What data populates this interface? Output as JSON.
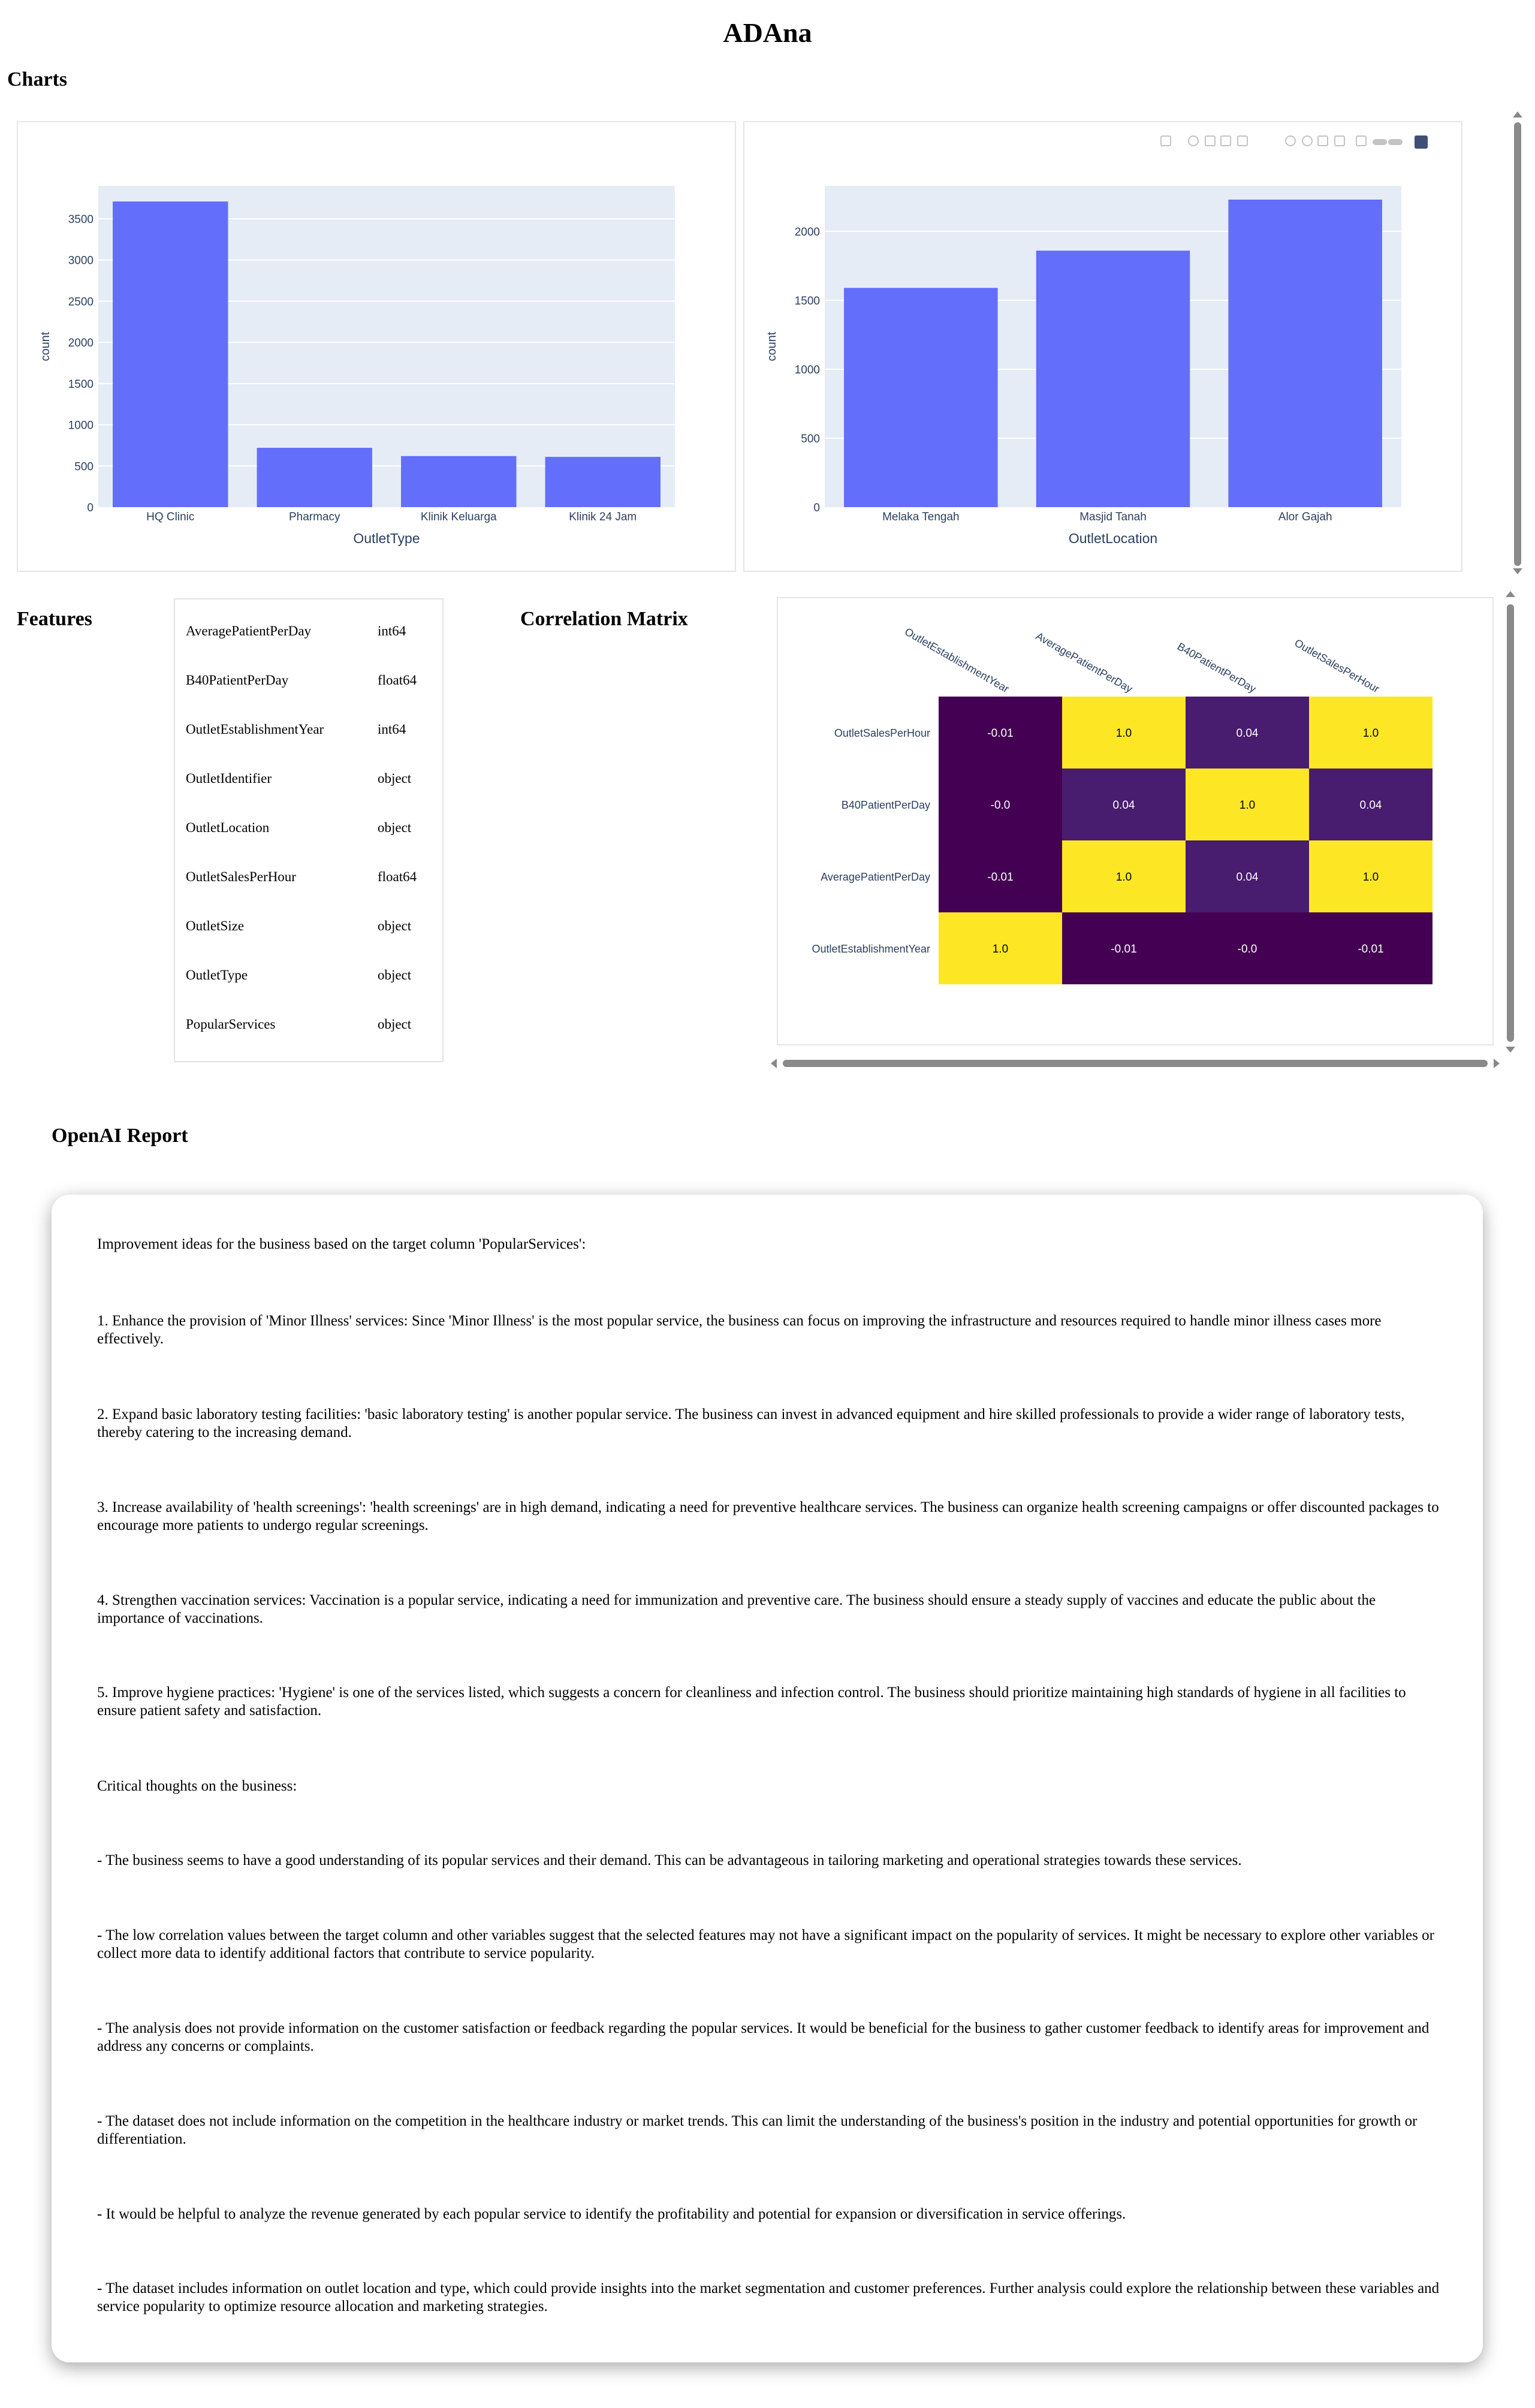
{
  "app": {
    "title": "ADAna"
  },
  "sections": {
    "charts": "Charts",
    "features": "Features",
    "correlation": "Correlation Matrix",
    "report": "OpenAI Report"
  },
  "colors": {
    "bar": "#636efa",
    "plot_bg": "#e5ecf6",
    "heat_low": "#440154",
    "heat_mid": "#481c6e",
    "heat_high": "#fde725"
  },
  "toolbar": {
    "icons": [
      "camera-icon",
      "zoom-icon",
      "pan-icon",
      "box-select-icon",
      "lasso-select-icon",
      "zoom-in-icon",
      "zoom-out-icon",
      "autoscale-icon",
      "reset-axes-icon",
      "spike-lines-icon",
      "hover-closest-icon",
      "hover-compare-icon",
      "plotly-logo-icon"
    ]
  },
  "chart_data": [
    {
      "type": "bar",
      "categories": [
        "HQ Clinic",
        "Pharmacy",
        "Klinik Keluarga",
        "Klinik 24 Jam"
      ],
      "values": [
        3710,
        720,
        620,
        610
      ],
      "xlabel": "OutletType",
      "ylabel": "count",
      "ylim": [
        0,
        3900
      ],
      "yticks": [
        0,
        500,
        1000,
        1500,
        2000,
        2500,
        3000,
        3500
      ],
      "grid": true
    },
    {
      "type": "bar",
      "categories": [
        "Melaka Tengah",
        "Masjid Tanah",
        "Alor Gajah"
      ],
      "values": [
        1590,
        1860,
        2230
      ],
      "xlabel": "OutletLocation",
      "ylabel": "count",
      "ylim": [
        0,
        2330
      ],
      "yticks": [
        0,
        500,
        1000,
        1500,
        2000
      ],
      "grid": true
    },
    {
      "type": "heatmap",
      "x": [
        "OutletEstablishmentYear",
        "AveragePatientPerDay",
        "B40PatientPerDay",
        "OutletSalesPerHour"
      ],
      "y": [
        "OutletSalesPerHour",
        "B40PatientPerDay",
        "AveragePatientPerDay",
        "OutletEstablishmentYear"
      ],
      "labels": [
        [
          "-0.01",
          "1.0",
          "0.04",
          "1.0"
        ],
        [
          "-0.0",
          "0.04",
          "1.0",
          "0.04"
        ],
        [
          "-0.01",
          "1.0",
          "0.04",
          "1.0"
        ],
        [
          "1.0",
          "-0.01",
          "-0.0",
          "-0.01"
        ]
      ],
      "values": [
        [
          -0.01,
          1.0,
          0.04,
          1.0
        ],
        [
          0.0,
          0.04,
          1.0,
          0.04
        ],
        [
          -0.01,
          1.0,
          0.04,
          1.0
        ],
        [
          1.0,
          -0.01,
          0.0,
          -0.01
        ]
      ]
    }
  ],
  "features": [
    {
      "name": "AveragePatientPerDay",
      "dtype": "int64"
    },
    {
      "name": "B40PatientPerDay",
      "dtype": "float64"
    },
    {
      "name": "OutletEstablishmentYear",
      "dtype": "int64"
    },
    {
      "name": "OutletIdentifier",
      "dtype": "object"
    },
    {
      "name": "OutletLocation",
      "dtype": "object"
    },
    {
      "name": "OutletSalesPerHour",
      "dtype": "float64"
    },
    {
      "name": "OutletSize",
      "dtype": "object"
    },
    {
      "name": "OutletType",
      "dtype": "object"
    },
    {
      "name": "PopularServices",
      "dtype": "object"
    }
  ],
  "report": {
    "paragraphs": [
      "Improvement ideas for the business based on the target column 'PopularServices':",
      "1. Enhance the provision of 'Minor Illness' services: Since 'Minor Illness' is the most popular service, the business can focus on improving the infrastructure and resources required to handle minor illness cases more effectively.",
      "2. Expand basic laboratory testing facilities: 'basic laboratory testing' is another popular service. The business can invest in advanced equipment and hire skilled professionals to provide a wider range of laboratory tests, thereby catering to the increasing demand.",
      "3. Increase availability of 'health screenings': 'health screenings' are in high demand, indicating a need for preventive healthcare services. The business can organize health screening campaigns or offer discounted packages to encourage more patients to undergo regular screenings.",
      "4. Strengthen vaccination services: Vaccination is a popular service, indicating a need for immunization and preventive care. The business should ensure a steady supply of vaccines and educate the public about the importance of vaccinations.",
      "5. Improve hygiene practices: 'Hygiene' is one of the services listed, which suggests a concern for cleanliness and infection control. The business should prioritize maintaining high standards of hygiene in all facilities to ensure patient safety and satisfaction.",
      "Critical thoughts on the business:",
      "- The business seems to have a good understanding of its popular services and their demand. This can be advantageous in tailoring marketing and operational strategies towards these services.",
      "- The low correlation values between the target column and other variables suggest that the selected features may not have a significant impact on the popularity of services. It might be necessary to explore other variables or collect more data to identify additional factors that contribute to service popularity.",
      "- The analysis does not provide information on the customer satisfaction or feedback regarding the popular services. It would be beneficial for the business to gather customer feedback to identify areas for improvement and address any concerns or complaints.",
      "- The dataset does not include information on the competition in the healthcare industry or market trends. This can limit the understanding of the business's position in the industry and potential opportunities for growth or differentiation.",
      "- It would be helpful to analyze the revenue generated by each popular service to identify the profitability and potential for expansion or diversification in service offerings.",
      "- The dataset includes information on outlet location and type, which could provide insights into the market segmentation and customer preferences. Further analysis could explore the relationship between these variables and service popularity to optimize resource allocation and marketing strategies."
    ]
  }
}
